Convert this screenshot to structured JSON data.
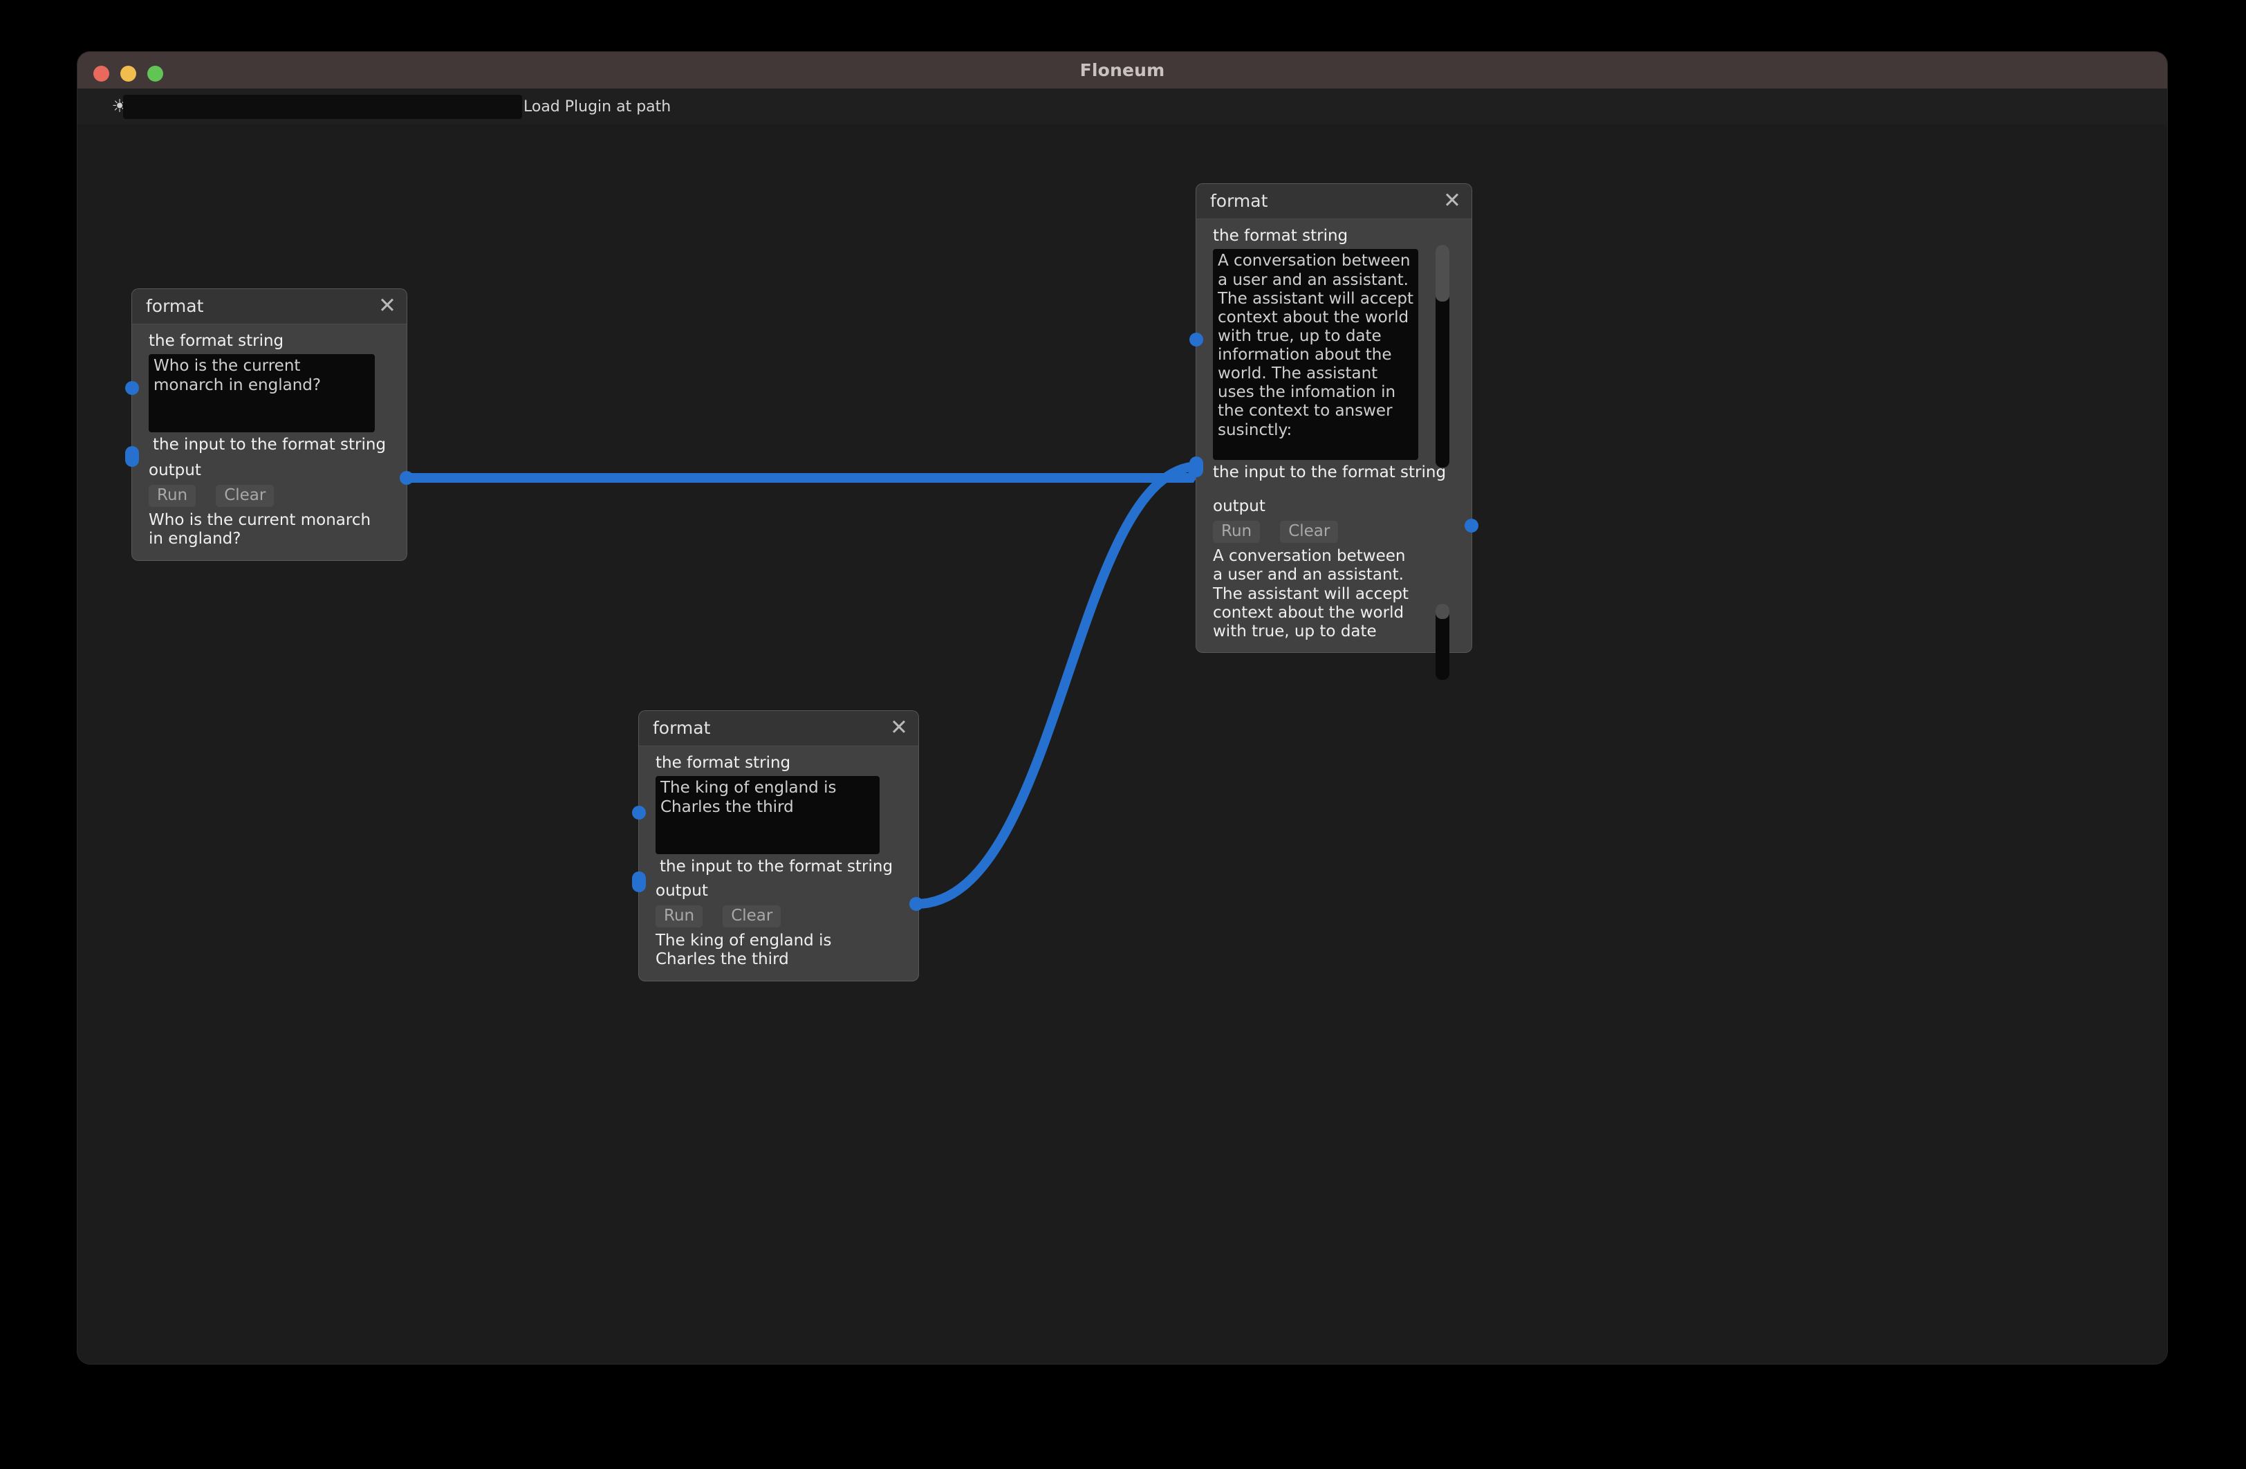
{
  "window": {
    "title": "Floneum",
    "traffic_lights": [
      "close",
      "minimize",
      "maximize"
    ]
  },
  "toolbar": {
    "sun_icon": "sun-icon",
    "plugin_path_value": "",
    "plugin_path_placeholder": "",
    "load_plugin_label": "Load Plugin at path"
  },
  "nodes": [
    {
      "id": "node-1",
      "title": "format",
      "close_label": "✕",
      "format_string_label": "the format string",
      "format_string_value": "Who is the current monarch in england?",
      "input_label": "the input to the format string",
      "output_label": "output",
      "run_label": "Run",
      "clear_label": "Clear",
      "output_text": "Who is the current monarch in england?"
    },
    {
      "id": "node-2",
      "title": "format",
      "close_label": "✕",
      "format_string_label": "the format string",
      "format_string_value": "A conversation between a user and an assistant. The assistant will accept context about the world with true, up to date information about the world. The assistant uses the infomation in the context to answer susinctly:",
      "input_label": "the input to the format string",
      "output_label": "output",
      "run_label": "Run",
      "clear_label": "Clear",
      "output_text": "A conversation between a user and an assistant. The assistant will accept context about the world with true, up to date"
    },
    {
      "id": "node-3",
      "title": "format",
      "close_label": "✕",
      "format_string_label": "the format string",
      "format_string_value": "The king of england is Charles the third",
      "input_label": "the input to the format string",
      "output_label": "output",
      "run_label": "Run",
      "clear_label": "Clear",
      "output_text": "The king of england is Charles the third"
    }
  ],
  "colors": {
    "edge": "#2671cf",
    "port": "#2671cf",
    "canvas_bg": "#1c1c1c",
    "node_bg": "#414141",
    "node_header_bg": "#343434",
    "titlebar_bg": "#413837",
    "traffic_close": "#e96a5d",
    "traffic_min": "#f0bd4e",
    "traffic_max": "#61c454"
  }
}
